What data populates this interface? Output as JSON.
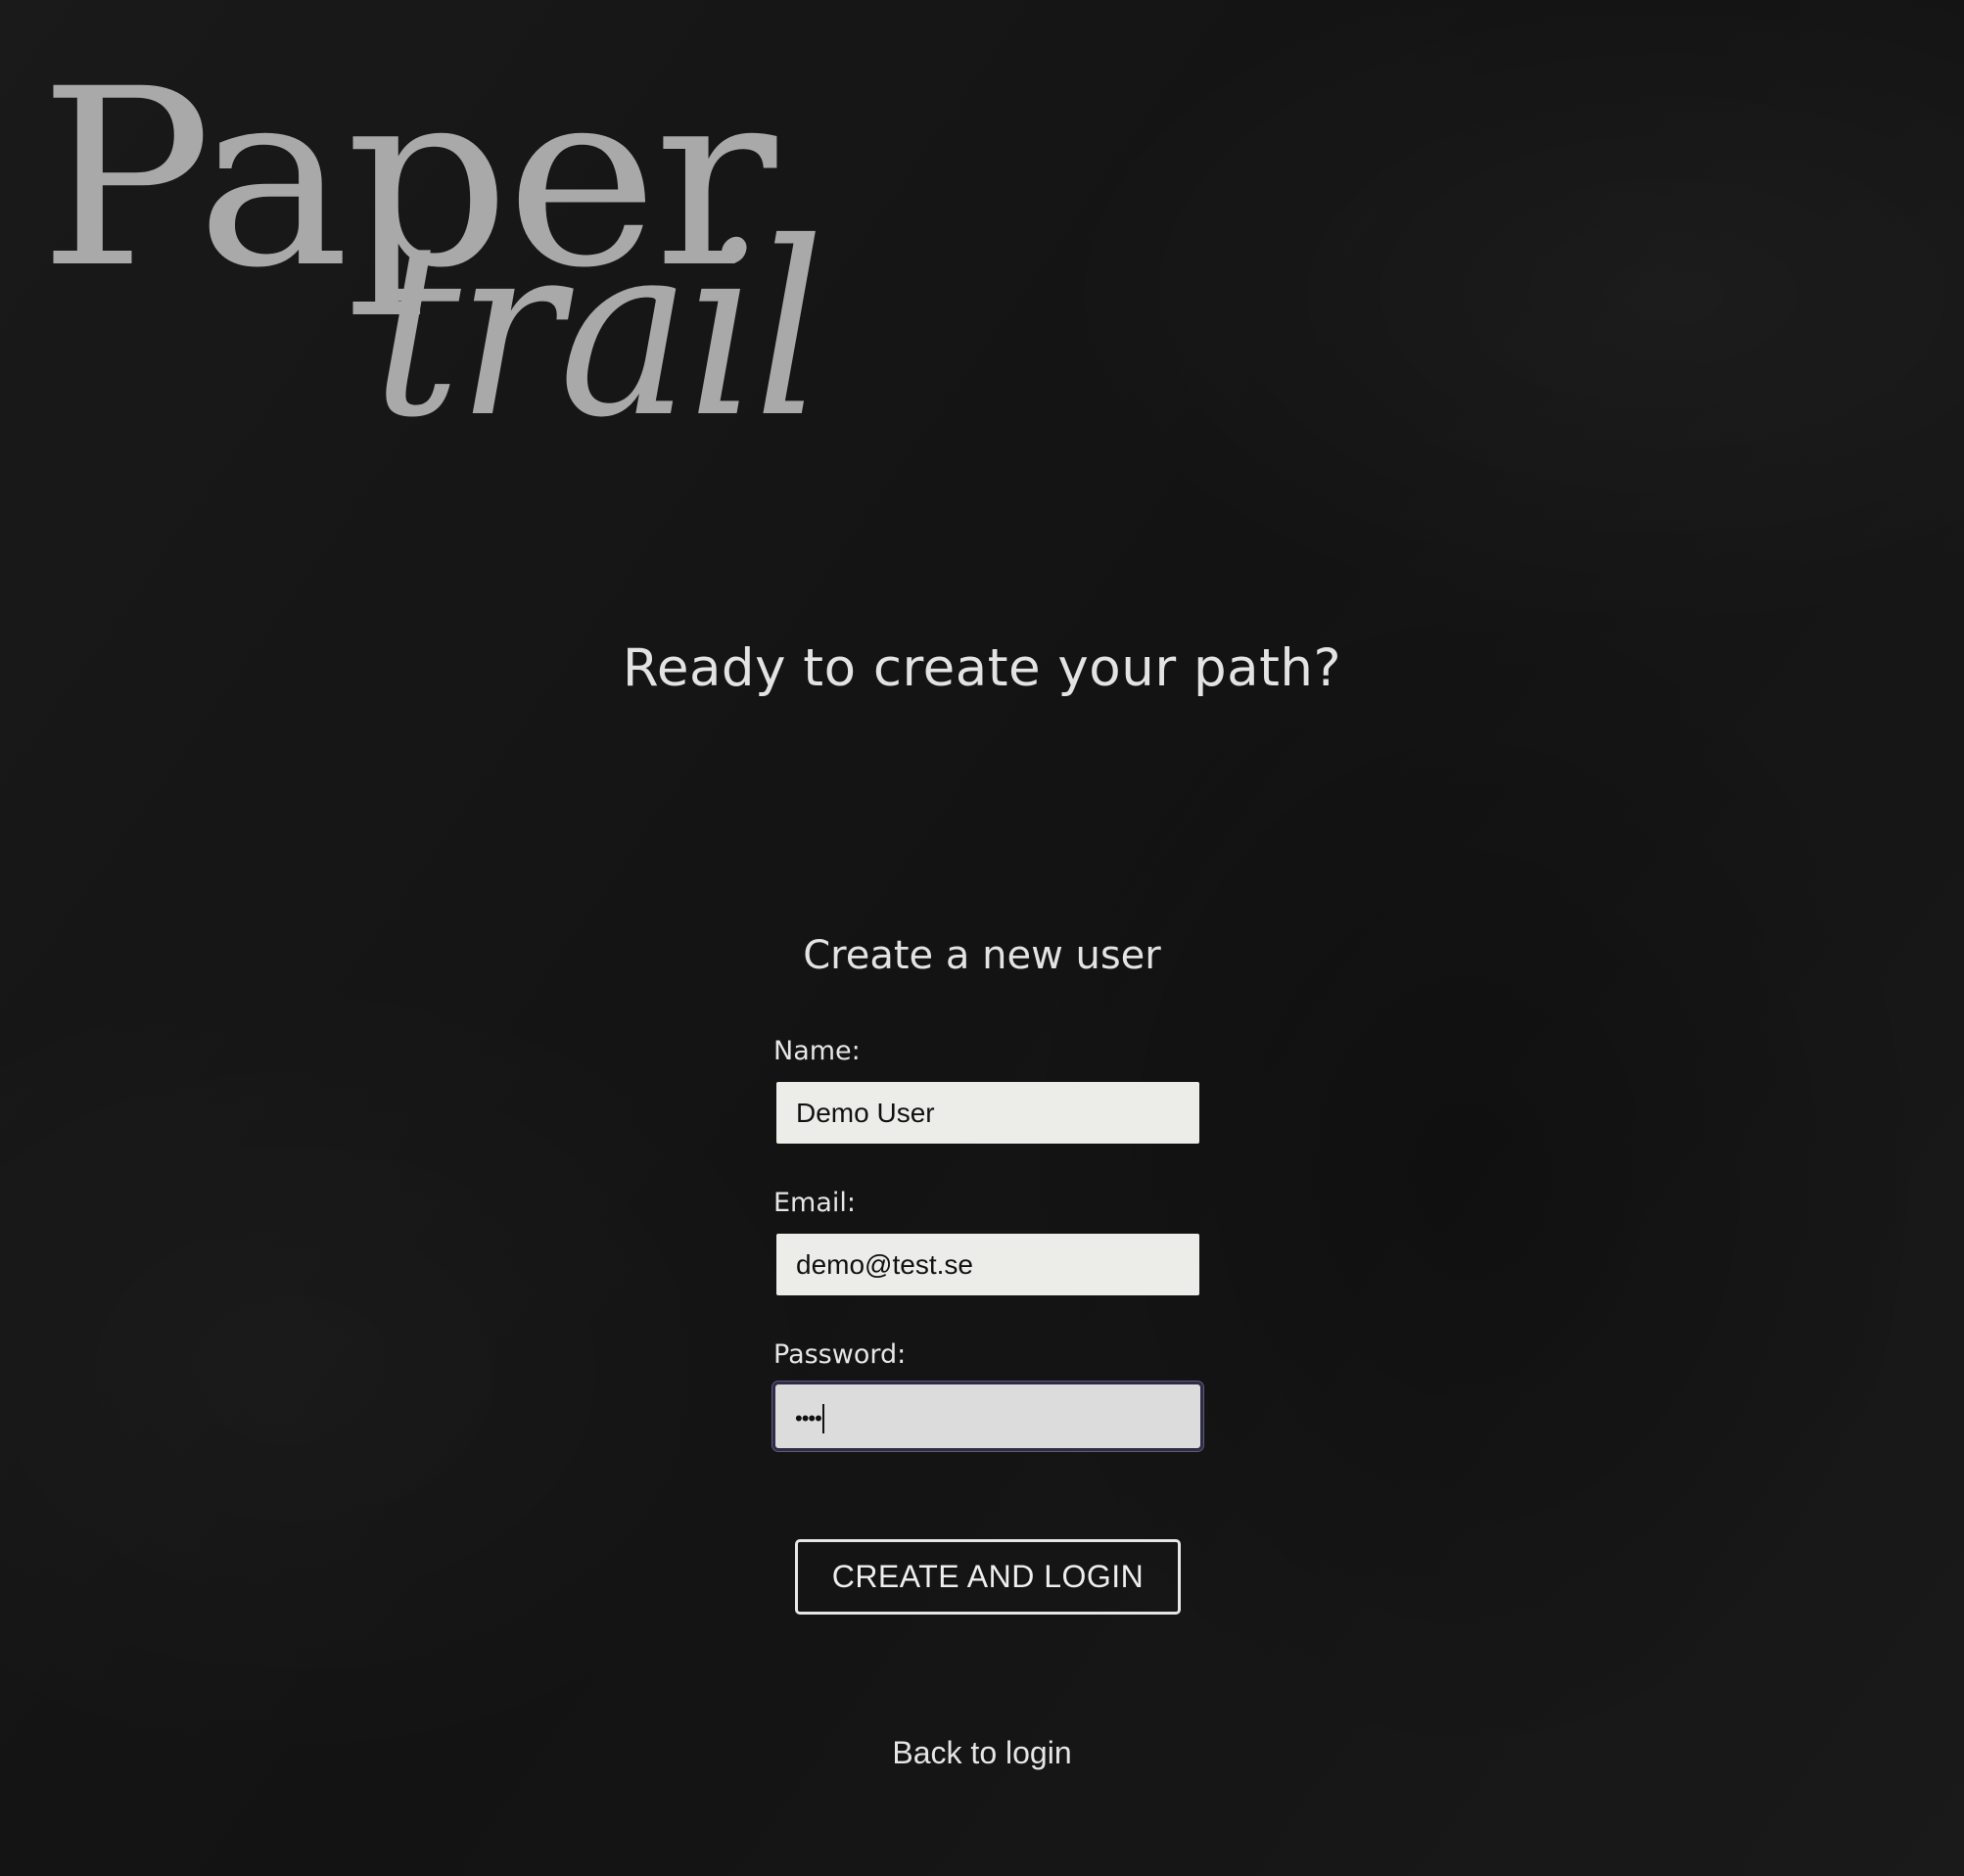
{
  "logo": {
    "line1": "Paper",
    "line2": "trail"
  },
  "headline": "Ready to create your path?",
  "form": {
    "title": "Create a new user",
    "fields": [
      {
        "label": "Name:",
        "value": "Demo User",
        "type": "text"
      },
      {
        "label": "Email:",
        "value": "demo@test.se",
        "type": "email"
      },
      {
        "label": "Password:",
        "value": "••••",
        "type": "password",
        "focused": true
      }
    ],
    "submit_label": "CREATE AND LOGIN"
  },
  "back_link": "Back to login",
  "colors": {
    "background": "#141414",
    "input_bg": "#ecede8",
    "input_focus_bg": "#dcdcdc",
    "focus_ring": "#2f2d45",
    "text": "#e6e6e6",
    "logo": "#a9a9a9"
  }
}
